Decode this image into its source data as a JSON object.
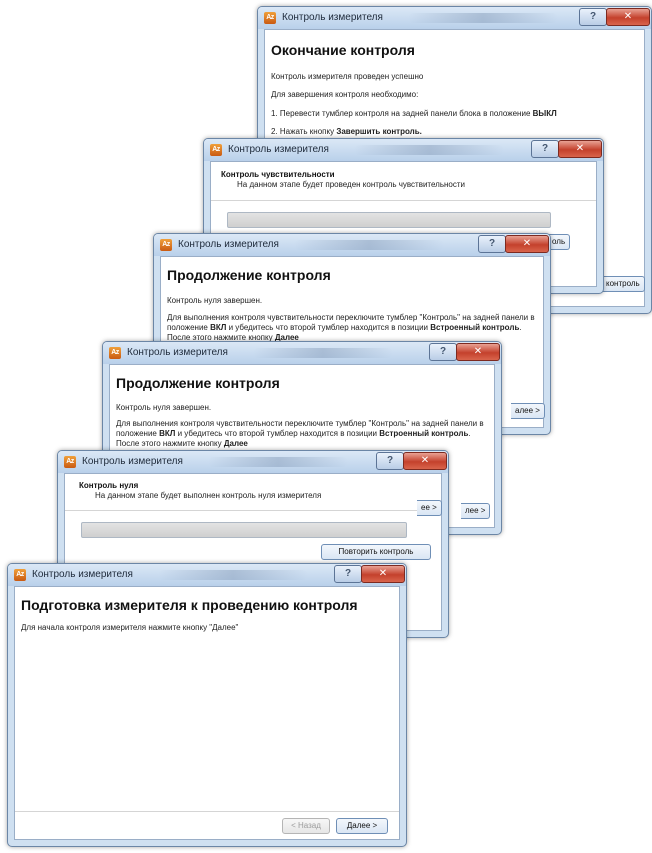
{
  "windows": {
    "finish": {
      "title": "Контроль измерителя",
      "heading": "Окончание контроля",
      "line1": "Контроль измерителя проведен успешно",
      "line2": "Для завершения контроля необходимо:",
      "step1_prefix": "1. Перевести тумблер контроля на задней панели блока в положение ",
      "step1_bold": "ВЫКЛ",
      "step2_prefix": "2. Нажать кнопку ",
      "step2_bold": "Завершить контроль.",
      "finish_button": "контроль"
    },
    "sensitivity": {
      "title": "Контроль измерителя",
      "heading": "Контроль чувствительности",
      "subtitle": "На данном этапе будет проведен контроль чувствительности",
      "button_partial": "оль"
    },
    "continue2": {
      "title": "Контроль измерителя",
      "heading": "Продолжение контроля",
      "line1": "Контроль нуля завершен.",
      "para_a": "Для выполнения контроля чувствительности переключите тумблер \"Контроль\" на задней панели в положение ",
      "para_bold1": "ВКЛ",
      "para_b": " и убедитесь что второй тумблер находится в позиции ",
      "para_bold2": "Встроенный контроль",
      "para_c": ". После этого нажмите кнопку ",
      "para_bold3": "Далее",
      "next_partial": "алее >"
    },
    "continue1": {
      "title": "Контроль измерителя",
      "heading": "Продолжение контроля",
      "line1": "Контроль нуля завершен.",
      "para_a": "Для выполнения контроля чувствительности переключите тумблер \"Контроль\" на задней панели в положение ",
      "para_bold1": "ВКЛ",
      "para_b": " и убедитесь что второй тумблер находится в позиции ",
      "para_bold2": "Встроенный контроль",
      "para_c": ". После этого нажмите кнопку ",
      "para_bold3": "Далее",
      "next_partial": "лее >"
    },
    "zero": {
      "title": "Контроль измерителя",
      "heading": "Контроль нуля",
      "subtitle": "На данном этапе будет выполнен контроль нуля измерителя",
      "repeat_button": "Повторить контроль",
      "next_partial": "ee >"
    },
    "prepare": {
      "title": "Контроль измерителя",
      "heading": "Подготовка измерителя к проведению контроля",
      "line1": "Для начала контроля измерителя нажмите кнопку \"Далее\"",
      "back_button": "< Назад",
      "next_button": "Далее >"
    }
  },
  "icons": {
    "app": "app-icon",
    "help": "?",
    "close": "✕",
    "app_glyph": "Az"
  },
  "colors": {
    "titlebar": "#b9d0ea",
    "close": "#c4412c",
    "progress": "#5fbf3c"
  },
  "progress": {
    "sensitivity_fraction": 0,
    "zero_fraction": 0
  }
}
